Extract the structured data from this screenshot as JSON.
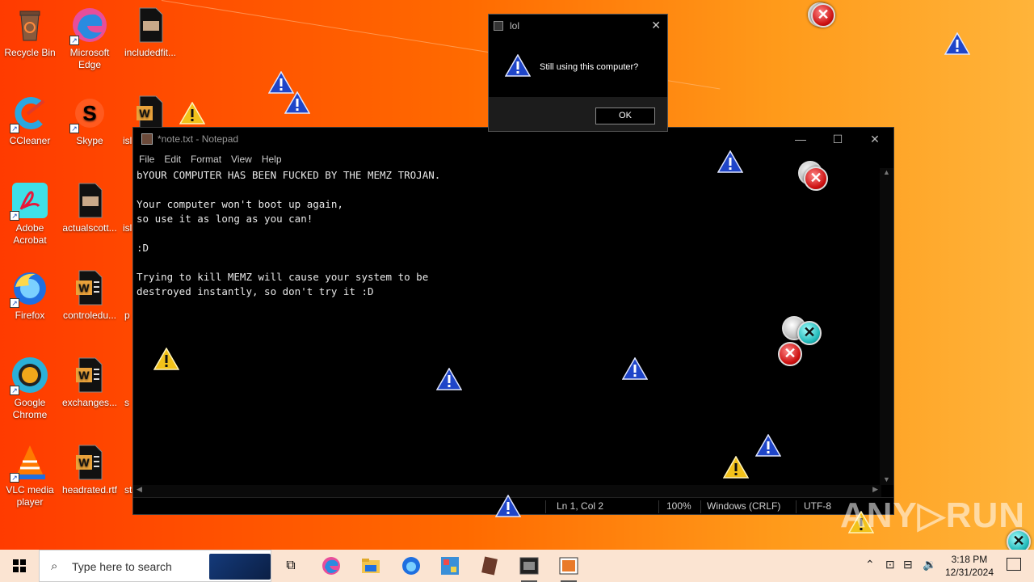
{
  "desktop": {
    "icons": [
      {
        "label": "Recycle Bin",
        "icon": "recycle-bin-icon"
      },
      {
        "label": "Microsoft Edge",
        "icon": "edge-icon"
      },
      {
        "label": "includedfit...",
        "icon": "file-icon"
      },
      {
        "label": "CCleaner",
        "icon": "ccleaner-icon"
      },
      {
        "label": "Skype",
        "icon": "skype-icon"
      },
      {
        "label": "isl",
        "icon": "word-doc-icon"
      },
      {
        "label": "Adobe Acrobat",
        "icon": "acrobat-icon"
      },
      {
        "label": "actualscott...",
        "icon": "file-icon"
      },
      {
        "label": "isl",
        "icon": "file-icon"
      },
      {
        "label": "Firefox",
        "icon": "firefox-icon"
      },
      {
        "label": "controledu...",
        "icon": "word-doc-icon"
      },
      {
        "label": "p",
        "icon": "file-icon"
      },
      {
        "label": "Google Chrome",
        "icon": "chrome-icon"
      },
      {
        "label": "exchanges...",
        "icon": "word-doc-icon"
      },
      {
        "label": "s",
        "icon": "file-icon"
      },
      {
        "label": "VLC media player",
        "icon": "vlc-icon"
      },
      {
        "label": "headrated.rtf",
        "icon": "word-doc-icon"
      },
      {
        "label": "st",
        "icon": "file-icon"
      }
    ]
  },
  "dialog": {
    "title": "lol",
    "message": "Still using this computer?",
    "ok_label": "OK",
    "close_symbol": "✕"
  },
  "notepad": {
    "title": "*note.txt - Notepad",
    "menu": [
      "File",
      "Edit",
      "Format",
      "View",
      "Help"
    ],
    "content": "bYOUR COMPUTER HAS BEEN FUCKED BY THE MEMZ TROJAN.\n\nYour computer won't boot up again,\nso use it as long as you can!\n\n:D\n\nTrying to kill MEMZ will cause your system to be\ndestroyed instantly, so don't try it :D",
    "status": {
      "position": "Ln 1, Col 2",
      "zoom": "100%",
      "line_ending": "Windows (CRLF)",
      "encoding": "UTF-8"
    },
    "controls": {
      "minimize": "—",
      "maximize": "☐",
      "close": "✕"
    }
  },
  "watermark": "ANY▷RUN",
  "taskbar": {
    "search_placeholder": "Type here to search",
    "clock_time": "3:18 PM",
    "clock_date": "12/31/2024",
    "pinned": [
      "task-view-icon",
      "edge-icon",
      "file-explorer-icon",
      "firefox-icon",
      "photo-app-icon",
      "winrar-icon",
      "terminal-icon",
      "notepad-app-icon"
    ]
  }
}
